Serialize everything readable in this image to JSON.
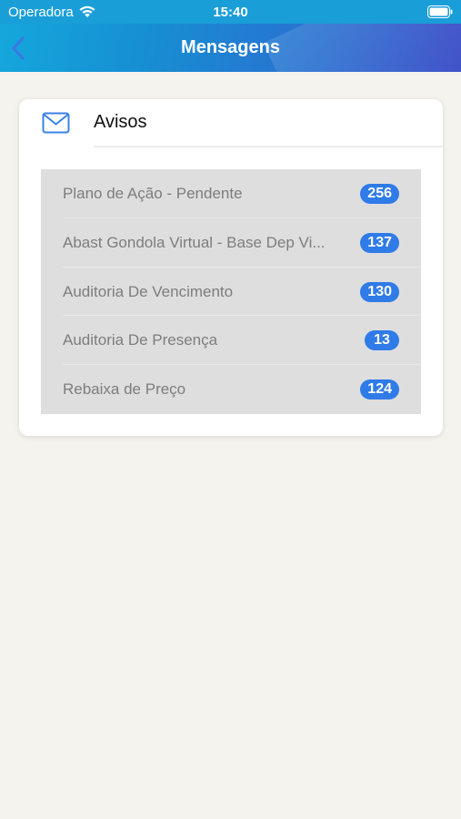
{
  "status_bar": {
    "carrier": "Operadora",
    "time": "15:40"
  },
  "nav": {
    "title": "Mensagens",
    "back_icon": "chevron-left-icon"
  },
  "card": {
    "icon": "mail-icon",
    "title": "Avisos",
    "items": [
      {
        "label": "Plano de Ação - Pendente",
        "count": "256"
      },
      {
        "label": "Abast Gondola Virtual - Base Dep Vi...",
        "count": "137"
      },
      {
        "label": "Auditoria De Vencimento",
        "count": "130"
      },
      {
        "label": "Auditoria De Presença",
        "count": "13"
      },
      {
        "label": "Rebaixa de Preço",
        "count": "124"
      }
    ]
  },
  "colors": {
    "nav_start": "#15a7dc",
    "nav_end": "#3d4ec7",
    "badge": "#2f7be8",
    "background": "#f4f3ee"
  }
}
